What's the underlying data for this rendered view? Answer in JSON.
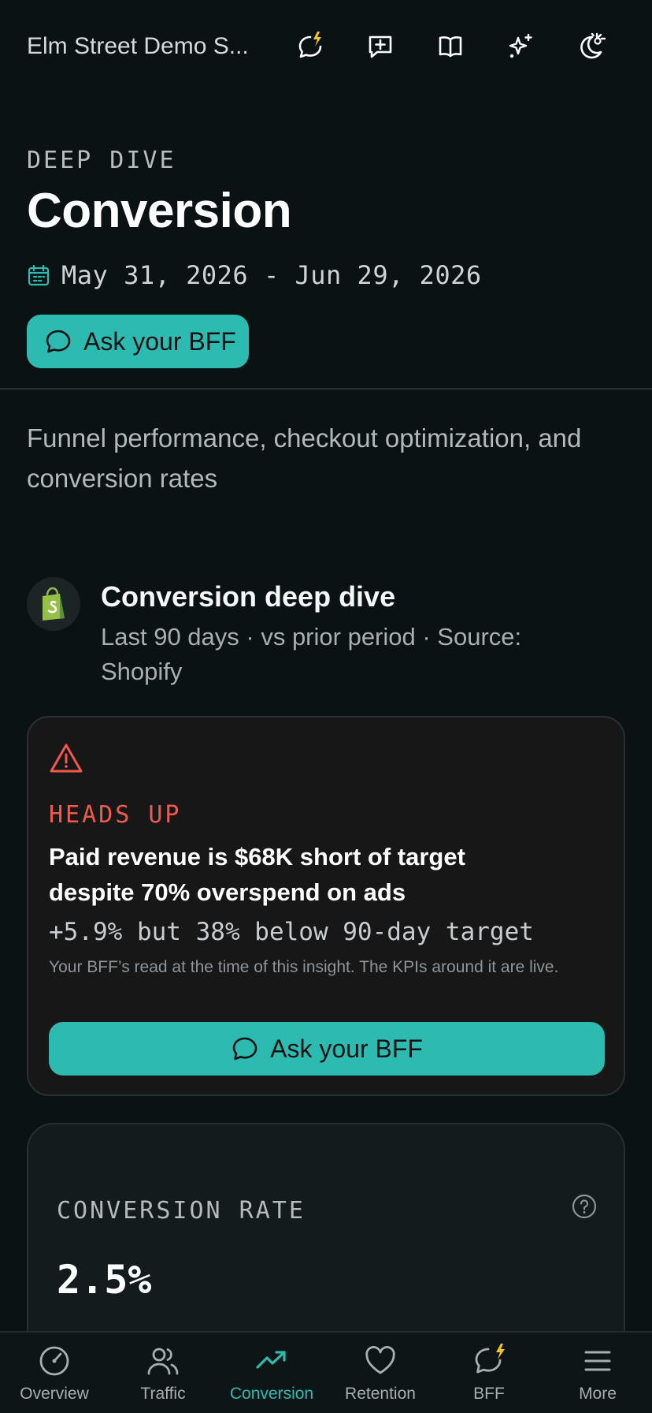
{
  "header": {
    "store_name": "Elm Street Demo S...",
    "icons": [
      "chat-bolt-icon",
      "add-comment-icon",
      "book-icon",
      "sparkles-icon",
      "theme-toggle-icon"
    ]
  },
  "page": {
    "eyebrow": "DEEP DIVE",
    "title": "Conversion",
    "date_range": "May 31, 2026 - Jun 29, 2026",
    "ask_button": "Ask your BFF",
    "description": "Funnel performance, checkout optimization, and conversion rates"
  },
  "source": {
    "title": "Conversion deep dive",
    "subtitle": "Last 90 days · vs prior period · Source: Shopify"
  },
  "alert": {
    "eyebrow": "HEADS UP",
    "headline": "Paid revenue is $68K short of target despite 70% overspend on ads",
    "metric": "+5.9% but 38% below 90-day target",
    "note": "Your BFF’s read at the time of this insight. The KPIs around it are live.",
    "ask_button": "Ask your BFF"
  },
  "kpi": {
    "label": "CONVERSION RATE",
    "value": "2.5%"
  },
  "nav": {
    "items": [
      {
        "label": "Overview"
      },
      {
        "label": "Traffic"
      },
      {
        "label": "Conversion"
      },
      {
        "label": "Retention"
      },
      {
        "label": "BFF"
      },
      {
        "label": "More"
      }
    ],
    "active": "Conversion"
  },
  "colors": {
    "accent": "#2dbab0",
    "warning": "#ef5a4f",
    "background": "#0b1214",
    "bolt": "#f5c518"
  }
}
